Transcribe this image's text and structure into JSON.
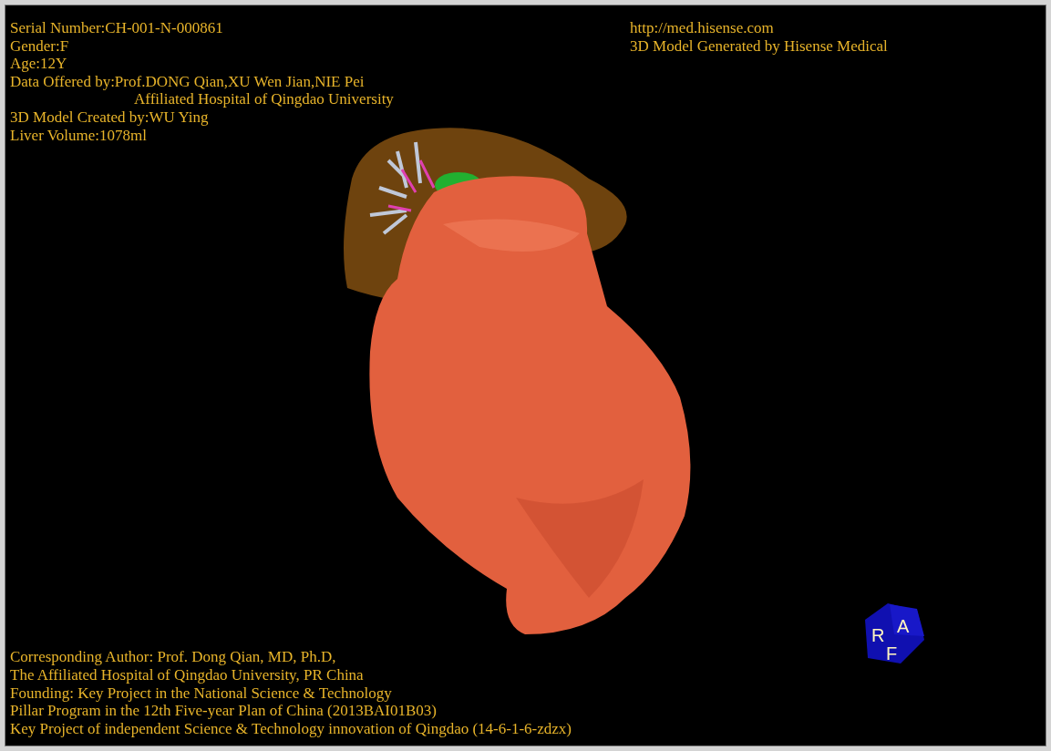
{
  "header_left": [
    {
      "text": "Serial Number:CH-001-N-000861",
      "kind": "line"
    },
    {
      "text": "Gender:F",
      "kind": "line"
    },
    {
      "text": "Age:12Y",
      "kind": "line"
    },
    {
      "text": "Data Offered by:Prof.DONG Qian,XU Wen Jian,NIE Pei",
      "kind": "line"
    },
    {
      "text": "Affiliated Hospital of Qingdao University",
      "kind": "continuation"
    },
    {
      "text": "3D Model Created by:WU Ying",
      "kind": "line"
    },
    {
      "text": "Liver Volume:1078ml",
      "kind": "line"
    }
  ],
  "header_right": [
    "http://med.hisense.com",
    "3D Model Generated by Hisense Medical"
  ],
  "footer": [
    "Corresponding Author: Prof. Dong Qian, MD, Ph.D,",
    "The Affiliated Hospital of Qingdao University, PR China",
    "Founding: Key Project in the National Science & Technology",
    "Pillar Program in the 12th Five-year Plan of China (2013BAI01B03)",
    "Key Project of independent Science & Technology innovation of Qingdao (14-6-1-6-zdzx)"
  ],
  "orientation_cube": {
    "labels": [
      "R",
      "A",
      "F"
    ]
  }
}
